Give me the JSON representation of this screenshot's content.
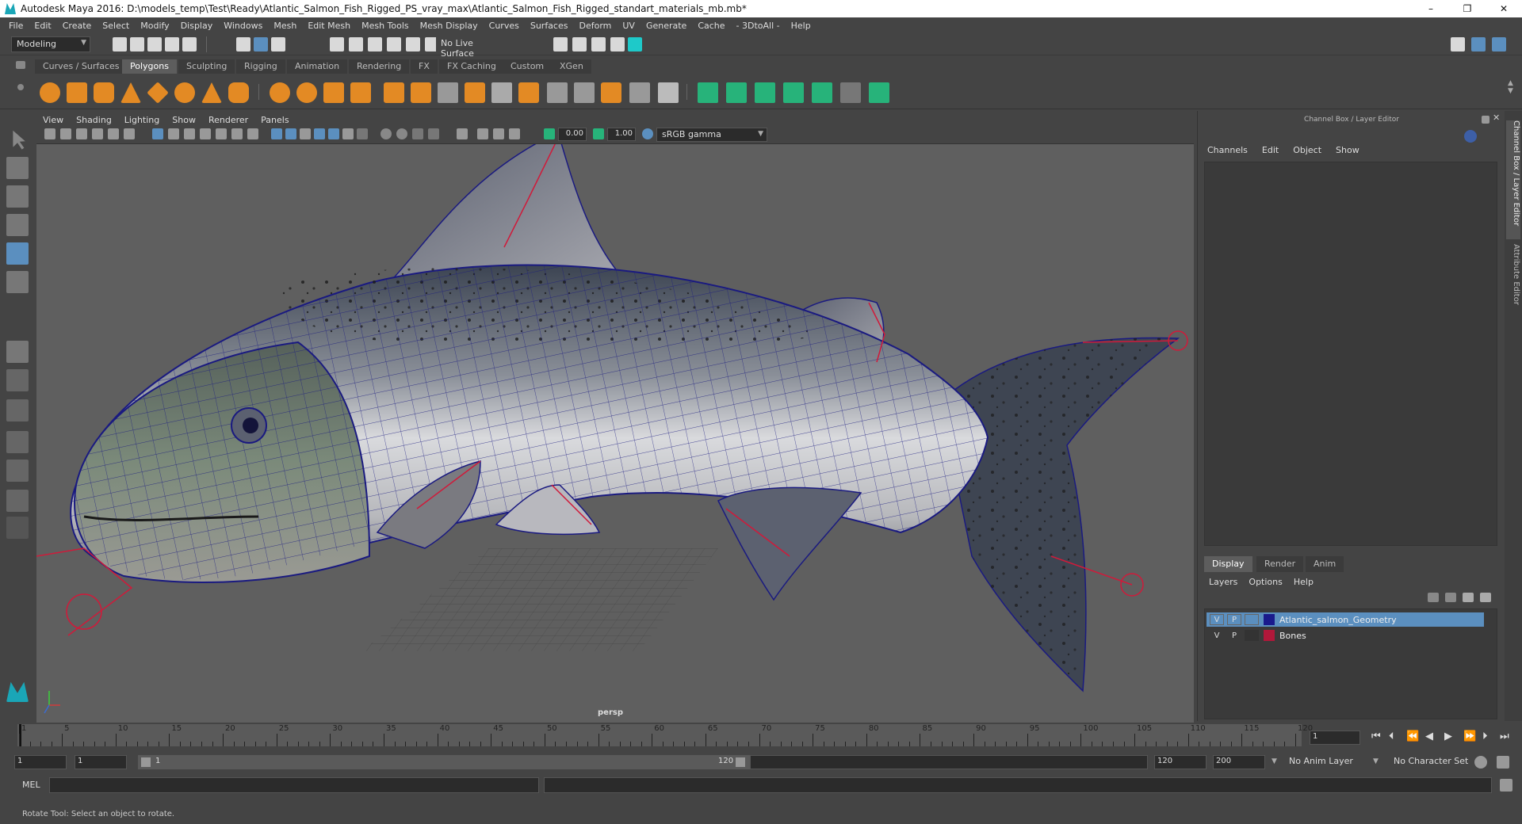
{
  "window": {
    "title": "Autodesk Maya 2016: D:\\models_temp\\Test\\Ready\\Atlantic_Salmon_Fish_Rigged_PS_vray_max\\Atlantic_Salmon_Fish_Rigged_standart_materials_mb.mb*",
    "minimize": "–",
    "restore": "❐",
    "close": "✕"
  },
  "menubar": [
    "File",
    "Edit",
    "Create",
    "Select",
    "Modify",
    "Display",
    "Windows",
    "Mesh",
    "Edit Mesh",
    "Mesh Tools",
    "Mesh Display",
    "Curves",
    "Surfaces",
    "Deform",
    "UV",
    "Generate",
    "Cache",
    "- 3DtoAll -",
    "Help"
  ],
  "statusline": {
    "mode": "Modeling",
    "live_surface": "No Live Surface"
  },
  "shelf": {
    "tabs": [
      "Curves / Surfaces",
      "Polygons",
      "Sculpting",
      "Rigging",
      "Animation",
      "Rendering",
      "FX",
      "FX Caching",
      "Custom",
      "XGen"
    ],
    "active_tab": "Polygons"
  },
  "viewport": {
    "menu": [
      "View",
      "Shading",
      "Lighting",
      "Show",
      "Renderer",
      "Panels"
    ],
    "exposure": "0.00",
    "gamma": "1.00",
    "color_space": "sRGB gamma",
    "camera_label": "persp"
  },
  "channel_box": {
    "title": "Channel Box / Layer Editor",
    "menu": [
      "Channels",
      "Edit",
      "Object",
      "Show"
    ],
    "side_tabs": [
      "Channel Box / Layer Editor",
      "Attribute Editor"
    ]
  },
  "layer_editor": {
    "tabs": [
      "Display",
      "Render",
      "Anim"
    ],
    "active_tab": "Display",
    "menu": [
      "Layers",
      "Options",
      "Help"
    ],
    "layers": [
      {
        "v": "V",
        "p": "P",
        "name": "Atlantic_salmon_Geometry",
        "color": "#1a1a8c",
        "selected": true
      },
      {
        "v": "V",
        "p": "P",
        "name": "Bones",
        "color": "#b0183a",
        "selected": false
      }
    ]
  },
  "timeline": {
    "labels": [
      "1",
      "5",
      "10",
      "15",
      "20",
      "25",
      "30",
      "35",
      "40",
      "45",
      "50",
      "55",
      "60",
      "65",
      "70",
      "75",
      "80",
      "85",
      "90",
      "95",
      "100",
      "105",
      "110",
      "115",
      "120"
    ],
    "current_frame": "1"
  },
  "range": {
    "start": "1",
    "playback_start": "1",
    "range_start": "1",
    "range_end": "120",
    "playback_end": "120",
    "end": "200",
    "anim_layer": "No Anim Layer",
    "character_set": "No Character Set"
  },
  "command_line": {
    "label": "MEL"
  },
  "help_line": "Rotate Tool: Select an object to rotate."
}
